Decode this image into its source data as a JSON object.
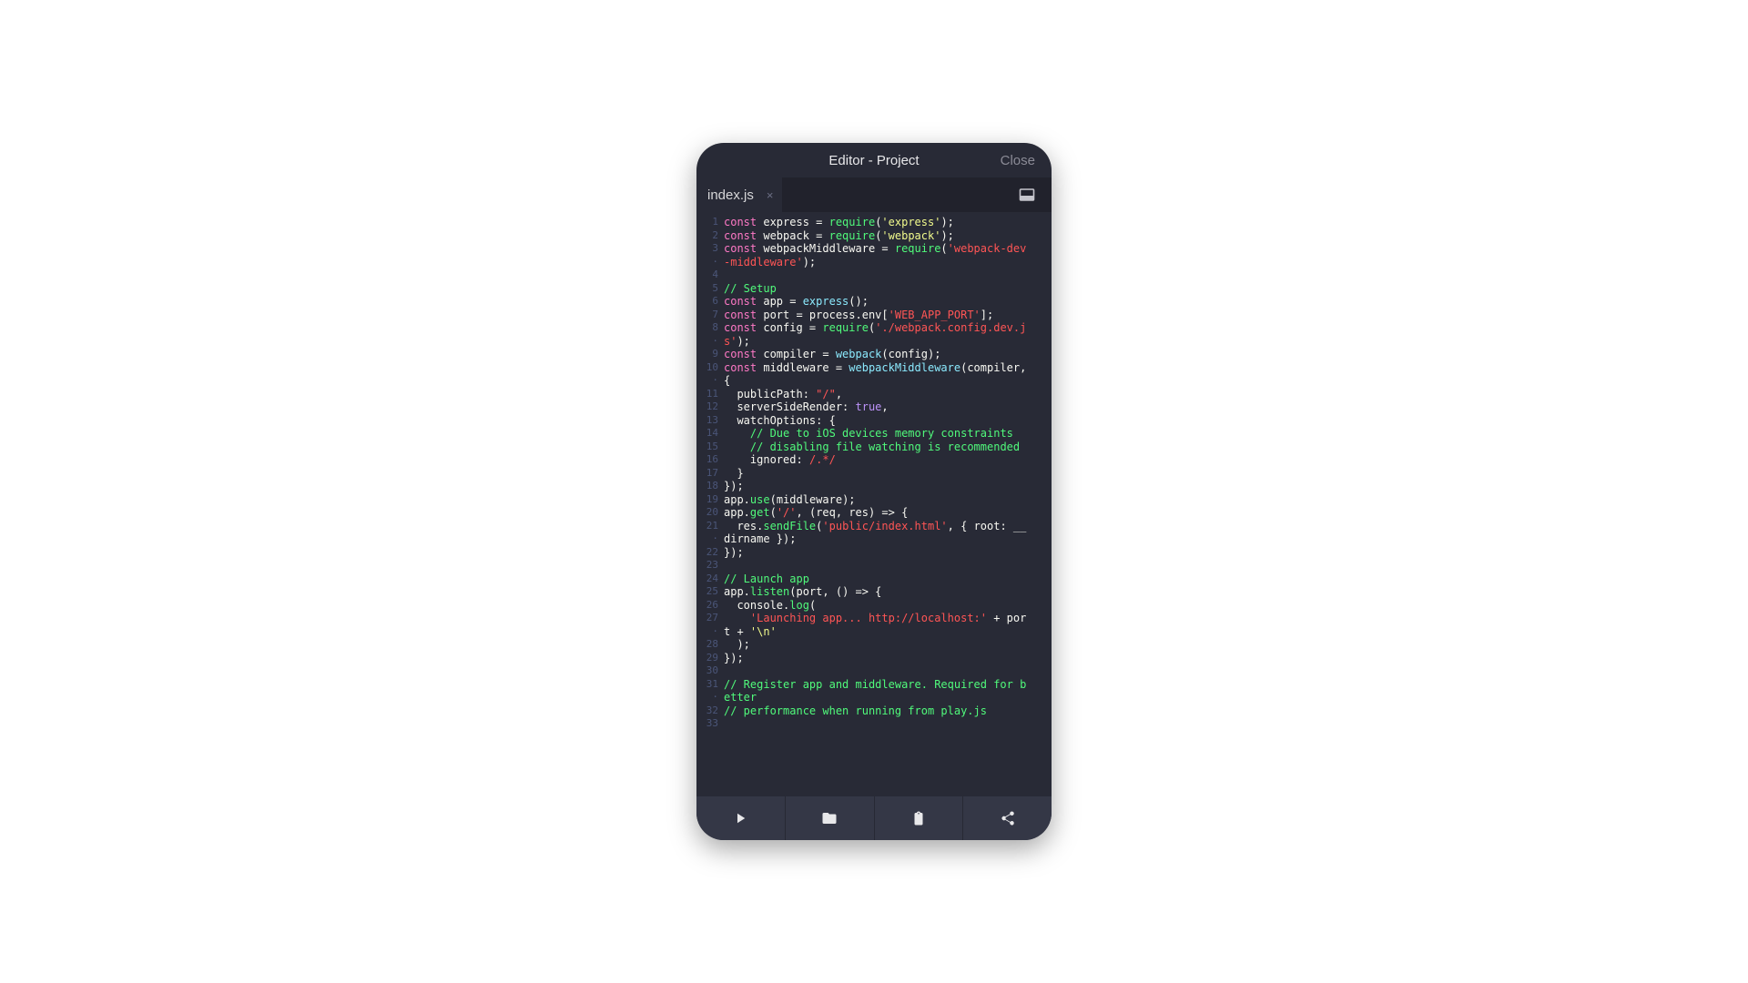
{
  "header": {
    "title": "Editor - Project",
    "close_label": "Close"
  },
  "tabs": [
    {
      "label": "index.js"
    }
  ],
  "icons": {
    "tab_close": "×",
    "panel_toggle": "panel-toggle-icon",
    "play": "play-icon",
    "folder": "folder-icon",
    "clipboard": "clipboard-icon",
    "share": "share-icon"
  },
  "colors": {
    "bg": "#282a36",
    "bg_alt": "#21222c",
    "toolbar": "#343746",
    "text": "#f8f8f2",
    "muted": "#8b8b96",
    "line_num": "#6272a4",
    "keyword": "#ff79c6",
    "func": "#50fa7b",
    "call": "#8be9fd",
    "string_red": "#ff5555",
    "string_yel": "#f1fa8c",
    "comment": "#6272a4",
    "bool_num": "#bd93f9"
  },
  "code": {
    "line_numbers": [
      1,
      2,
      3,
      "·",
      4,
      5,
      6,
      7,
      8,
      "·",
      9,
      10,
      "·",
      11,
      12,
      13,
      14,
      15,
      16,
      17,
      18,
      19,
      20,
      21,
      "·",
      22,
      23,
      24,
      25,
      26,
      27,
      "·",
      28,
      29,
      30,
      31,
      "·",
      32,
      33
    ],
    "lines": [
      [
        [
          "kw",
          "const"
        ],
        [
          "name",
          " express = "
        ],
        [
          "fn",
          "require"
        ],
        [
          "name",
          "("
        ],
        [
          "str2",
          "'express'"
        ],
        [
          "name",
          ");"
        ]
      ],
      [
        [
          "kw",
          "const"
        ],
        [
          "name",
          " webpack = "
        ],
        [
          "fn",
          "require"
        ],
        [
          "name",
          "("
        ],
        [
          "str2",
          "'webpack'"
        ],
        [
          "name",
          ");"
        ]
      ],
      [
        [
          "kw",
          "const"
        ],
        [
          "name",
          " webpackMiddleware = "
        ],
        [
          "fn",
          "require"
        ],
        [
          "name",
          "("
        ],
        [
          "str",
          "'webpack-dev"
        ]
      ],
      [
        [
          "str",
          "-middleware'"
        ],
        [
          "name",
          ");"
        ]
      ],
      [
        [
          "name",
          ""
        ]
      ],
      [
        [
          "cmt2",
          "// Setup"
        ]
      ],
      [
        [
          "kw",
          "const"
        ],
        [
          "name",
          " app = "
        ],
        [
          "call",
          "express"
        ],
        [
          "name",
          "();"
        ]
      ],
      [
        [
          "kw",
          "const"
        ],
        [
          "name",
          " port = process.env["
        ],
        [
          "str",
          "'WEB_APP_PORT'"
        ],
        [
          "name",
          "];"
        ]
      ],
      [
        [
          "kw",
          "const"
        ],
        [
          "name",
          " config = "
        ],
        [
          "fn",
          "require"
        ],
        [
          "name",
          "("
        ],
        [
          "str",
          "'./webpack.config.dev.j"
        ]
      ],
      [
        [
          "str",
          "s'"
        ],
        [
          "name",
          ");"
        ]
      ],
      [
        [
          "kw",
          "const"
        ],
        [
          "name",
          " compiler = "
        ],
        [
          "call",
          "webpack"
        ],
        [
          "name",
          "(config);"
        ]
      ],
      [
        [
          "kw",
          "const"
        ],
        [
          "name",
          " middleware = "
        ],
        [
          "call",
          "webpackMiddleware"
        ],
        [
          "name",
          "(compiler, "
        ]
      ],
      [
        [
          "name",
          "{"
        ]
      ],
      [
        [
          "name",
          "  publicPath: "
        ],
        [
          "str",
          "\"/\""
        ],
        [
          "name",
          ","
        ]
      ],
      [
        [
          "name",
          "  serverSideRender: "
        ],
        [
          "bool",
          "true"
        ],
        [
          "name",
          ","
        ]
      ],
      [
        [
          "name",
          "  watchOptions: {"
        ]
      ],
      [
        [
          "name",
          "    "
        ],
        [
          "cmt2",
          "// Due to iOS devices memory constraints"
        ]
      ],
      [
        [
          "name",
          "    "
        ],
        [
          "cmt2",
          "// disabling file watching is recommended"
        ]
      ],
      [
        [
          "name",
          "    ignored: "
        ],
        [
          "re",
          "/.*/"
        ]
      ],
      [
        [
          "name",
          "  }"
        ]
      ],
      [
        [
          "name",
          "});"
        ]
      ],
      [
        [
          "name",
          "app."
        ],
        [
          "fn",
          "use"
        ],
        [
          "name",
          "(middleware);"
        ]
      ],
      [
        [
          "name",
          "app."
        ],
        [
          "fn",
          "get"
        ],
        [
          "name",
          "("
        ],
        [
          "str",
          "'/'"
        ],
        [
          "name",
          ", (req, res) => {"
        ]
      ],
      [
        [
          "name",
          "  res."
        ],
        [
          "fn",
          "sendFile"
        ],
        [
          "name",
          "("
        ],
        [
          "str",
          "'public/index.html'"
        ],
        [
          "name",
          ", { root: __"
        ]
      ],
      [
        [
          "name",
          "dirname });"
        ]
      ],
      [
        [
          "name",
          "});"
        ]
      ],
      [
        [
          "name",
          ""
        ]
      ],
      [
        [
          "cmt2",
          "// Launch app"
        ]
      ],
      [
        [
          "name",
          "app."
        ],
        [
          "fn",
          "listen"
        ],
        [
          "name",
          "(port, () => {"
        ]
      ],
      [
        [
          "name",
          "  console."
        ],
        [
          "fn",
          "log"
        ],
        [
          "name",
          "("
        ]
      ],
      [
        [
          "name",
          "    "
        ],
        [
          "str",
          "'Launching app... http://localhost:'"
        ],
        [
          "name",
          " + por"
        ]
      ],
      [
        [
          "name",
          "t + "
        ],
        [
          "str2",
          "'\\n'"
        ]
      ],
      [
        [
          "name",
          "  );"
        ]
      ],
      [
        [
          "name",
          "});"
        ]
      ],
      [
        [
          "name",
          ""
        ]
      ],
      [
        [
          "cmt2",
          "// Register app and middleware. Required for b"
        ]
      ],
      [
        [
          "cmt2",
          "etter"
        ]
      ],
      [
        [
          "cmt2",
          "// performance when running from play.js"
        ]
      ],
      [
        [
          "name",
          ""
        ]
      ]
    ]
  }
}
